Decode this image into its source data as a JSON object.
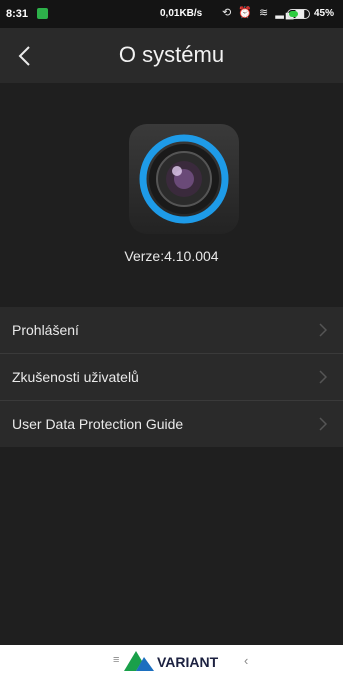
{
  "status_bar": {
    "time": "8:31",
    "net_speed": "0,01KB/s",
    "battery_pct": "45%",
    "battery_level": 0.45
  },
  "header": {
    "title": "O systému"
  },
  "about": {
    "version": "Verze:4.10.004"
  },
  "menu": {
    "items": [
      {
        "label": "Prohlášení"
      },
      {
        "label": "Zkušenosti uživatelů"
      },
      {
        "label": "User Data Protection Guide"
      }
    ]
  },
  "watermark": {
    "text": "VARIANT"
  },
  "colors": {
    "accent_ring": "#1e9be8",
    "background": "#1f1f1f",
    "header_bg": "#2a2a2a"
  }
}
